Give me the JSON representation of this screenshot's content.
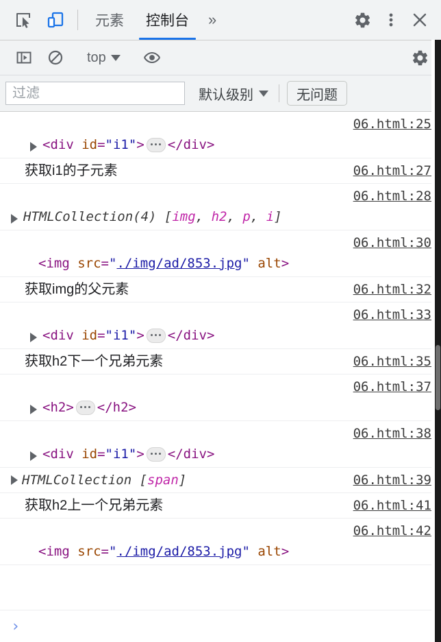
{
  "window": {
    "tabbar": {
      "inspect_icon": "inspect-element-icon",
      "device_icon": "device-toolbar-icon",
      "tabs": [
        {
          "label": "元素",
          "active": false
        },
        {
          "label": "控制台",
          "active": true
        }
      ],
      "more_tabs_label": "»",
      "settings_icon": "gear-icon",
      "more_options_icon": "kebab-menu-icon",
      "close_icon": "close-icon"
    },
    "console_toolbar": {
      "sidebar_toggle_icon": "console-sidebar-icon",
      "clear_icon": "clear-console-icon",
      "context_label": "top",
      "eye_icon": "live-expression-eye-icon",
      "settings_icon": "gear-icon"
    },
    "filterbar": {
      "filter_placeholder": "过滤",
      "filter_value": "",
      "level_label": "默认级别",
      "issues_label": "无问题"
    },
    "prompt": {
      "chevron": "›"
    }
  },
  "colors": {
    "accent": "#1a73e8",
    "toolbar_bg": "#f1f3f4",
    "tag": "#881280",
    "attr_name": "#994500",
    "attr_value": "#1a1aa6",
    "link": "#1a1aa6",
    "object": "#393939",
    "element_name": "#c026a8",
    "prompt": "#6c8fe8"
  },
  "messages": [
    {
      "id": "m1",
      "layout": "stacked",
      "kind": "dom",
      "expandable": true,
      "source": "06.html:25",
      "parts": [
        {
          "type": "tag",
          "text": "<div "
        },
        {
          "type": "attr",
          "text": "id"
        },
        {
          "type": "tag",
          "text": "="
        },
        {
          "type": "val",
          "text": "\"i1\""
        },
        {
          "type": "tag",
          "text": ">"
        },
        {
          "type": "ellipsis",
          "text": "…"
        },
        {
          "type": "tag",
          "text": "</div>"
        }
      ]
    },
    {
      "id": "m2",
      "layout": "inline",
      "kind": "text",
      "expandable": false,
      "source": "06.html:27",
      "text": "获取i1的子元素"
    },
    {
      "id": "m3",
      "layout": "stacked",
      "kind": "object",
      "expandable": true,
      "source": "06.html:28",
      "parts": [
        {
          "type": "obj",
          "text": "HTMLCollection(4) ["
        },
        {
          "type": "el",
          "text": "img"
        },
        {
          "type": "obj",
          "text": ", "
        },
        {
          "type": "el",
          "text": "h2"
        },
        {
          "type": "obj",
          "text": ", "
        },
        {
          "type": "el",
          "text": "p"
        },
        {
          "type": "obj",
          "text": ", "
        },
        {
          "type": "el",
          "text": "i"
        },
        {
          "type": "obj",
          "text": "]"
        }
      ]
    },
    {
      "id": "m4",
      "layout": "stacked",
      "kind": "dom",
      "expandable": false,
      "source": "06.html:30",
      "parts": [
        {
          "type": "tag",
          "text": "<img "
        },
        {
          "type": "attr",
          "text": "src"
        },
        {
          "type": "tag",
          "text": "="
        },
        {
          "type": "val",
          "text": "\""
        },
        {
          "type": "link",
          "text": "./img/ad/853.jpg"
        },
        {
          "type": "val",
          "text": "\""
        },
        {
          "type": "attr",
          "text": " alt"
        },
        {
          "type": "tag",
          "text": ">"
        }
      ]
    },
    {
      "id": "m5",
      "layout": "inline",
      "kind": "text",
      "expandable": false,
      "source": "06.html:32",
      "text": "获取img的父元素"
    },
    {
      "id": "m6",
      "layout": "stacked",
      "kind": "dom",
      "expandable": true,
      "source": "06.html:33",
      "parts": [
        {
          "type": "tag",
          "text": "<div "
        },
        {
          "type": "attr",
          "text": "id"
        },
        {
          "type": "tag",
          "text": "="
        },
        {
          "type": "val",
          "text": "\"i1\""
        },
        {
          "type": "tag",
          "text": ">"
        },
        {
          "type": "ellipsis",
          "text": "…"
        },
        {
          "type": "tag",
          "text": "</div>"
        }
      ]
    },
    {
      "id": "m7",
      "layout": "inline",
      "kind": "text",
      "expandable": false,
      "source": "06.html:35",
      "text": "获取h2下一个兄弟元素"
    },
    {
      "id": "m8",
      "layout": "stacked",
      "kind": "dom",
      "expandable": true,
      "source": "06.html:37",
      "parts": [
        {
          "type": "tag",
          "text": "<h2>"
        },
        {
          "type": "ellipsis",
          "text": "…"
        },
        {
          "type": "tag",
          "text": "</h2>"
        }
      ]
    },
    {
      "id": "m9",
      "layout": "stacked",
      "kind": "dom",
      "expandable": true,
      "source": "06.html:38",
      "parts": [
        {
          "type": "tag",
          "text": "<div "
        },
        {
          "type": "attr",
          "text": "id"
        },
        {
          "type": "tag",
          "text": "="
        },
        {
          "type": "val",
          "text": "\"i1\""
        },
        {
          "type": "tag",
          "text": ">"
        },
        {
          "type": "ellipsis",
          "text": "…"
        },
        {
          "type": "tag",
          "text": "</div>"
        }
      ]
    },
    {
      "id": "m10",
      "layout": "inline",
      "kind": "object",
      "expandable": true,
      "source": "06.html:39",
      "parts": [
        {
          "type": "obj",
          "text": "HTMLCollection ["
        },
        {
          "type": "el",
          "text": "span"
        },
        {
          "type": "obj",
          "text": "]"
        }
      ]
    },
    {
      "id": "m11",
      "layout": "inline",
      "kind": "text",
      "expandable": false,
      "source": "06.html:41",
      "text": "获取h2上一个兄弟元素"
    },
    {
      "id": "m12",
      "layout": "stacked",
      "kind": "dom",
      "expandable": false,
      "source": "06.html:42",
      "parts": [
        {
          "type": "tag",
          "text": "<img "
        },
        {
          "type": "attr",
          "text": "src"
        },
        {
          "type": "tag",
          "text": "="
        },
        {
          "type": "val",
          "text": "\""
        },
        {
          "type": "link",
          "text": "./img/ad/853.jpg"
        },
        {
          "type": "val",
          "text": "\""
        },
        {
          "type": "attr",
          "text": " alt"
        },
        {
          "type": "tag",
          "text": ">"
        }
      ]
    }
  ]
}
